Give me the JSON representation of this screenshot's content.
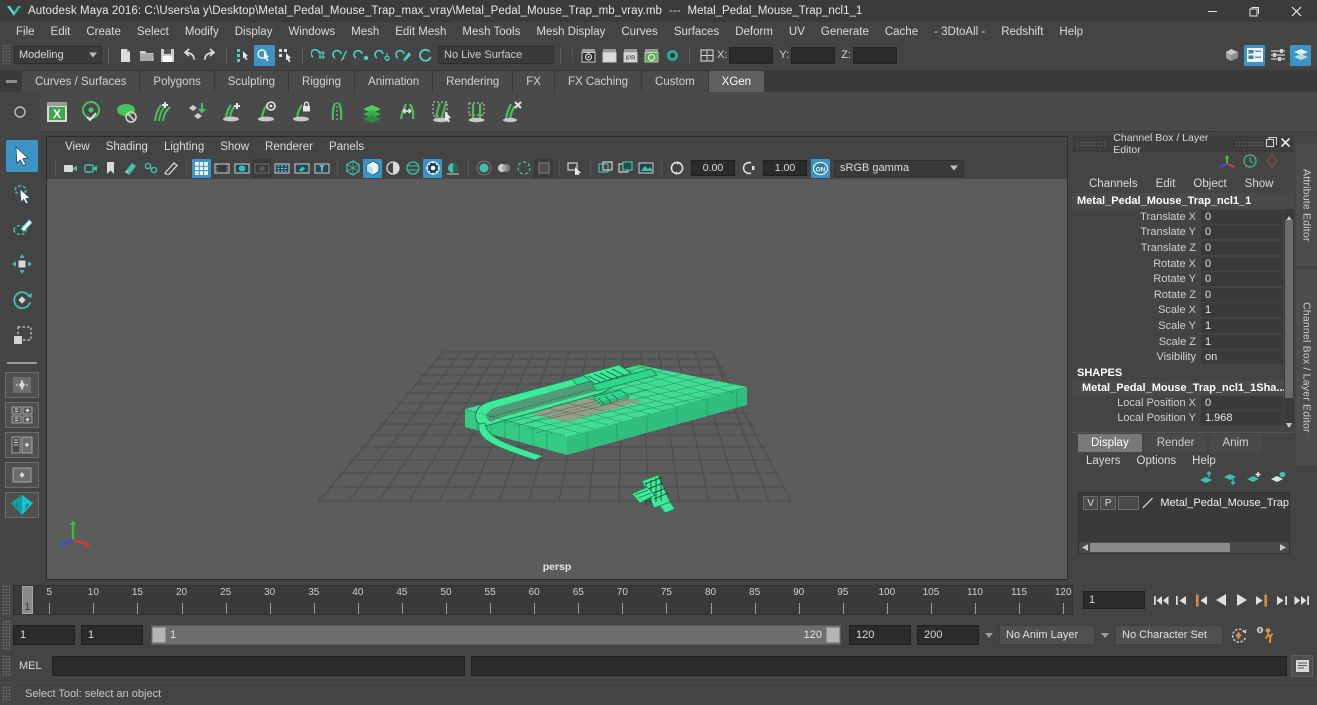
{
  "window": {
    "app_title": "Autodesk Maya 2016: C:\\Users\\a y\\Desktop\\Metal_Pedal_Mouse_Trap_max_vray\\Metal_Pedal_Mouse_Trap_mb_vray.mb",
    "separator": "---",
    "active_object": "Metal_Pedal_Mouse_Trap_ncl1_1",
    "minimize": "─",
    "maximize": "❐",
    "close": "✕"
  },
  "menubar": {
    "items": [
      "File",
      "Edit",
      "Create",
      "Select",
      "Modify",
      "Display",
      "Windows",
      "Mesh",
      "Edit Mesh",
      "Mesh Tools",
      "Mesh Display",
      "Curves",
      "Surfaces",
      "Deform",
      "UV",
      "Generate",
      "Cache",
      "- 3DtoAll -",
      "Redshift",
      "Help"
    ]
  },
  "statusline": {
    "menu_set": "Modeling",
    "live_surface": "No Live Surface",
    "axis_x_label": "X:",
    "axis_y_label": "Y:",
    "axis_z_label": "Z:",
    "axis_x_value": "",
    "axis_y_value": "",
    "axis_z_value": "",
    "icons": [
      "new-scene-icon",
      "open-scene-icon",
      "save-scene-icon",
      "undo-icon",
      "redo-icon",
      "select-by-hierarchy-icon",
      "select-by-object-icon",
      "select-by-component-icon",
      "snap-to-grid-icon",
      "snap-to-curve-icon",
      "snap-to-point-icon",
      "snap-to-projected-center-icon",
      "snap-to-view-plane-icon",
      "make-live-icon",
      "render-view-icon",
      "render-current-frame-icon",
      "ipr-render-icon",
      "render-settings-icon",
      "hypershade-icon",
      "input-output-connections-icon",
      "show-manipulator-icon",
      "attribute-editor-icon",
      "tool-settings-icon",
      "channel-box-icon"
    ]
  },
  "shelf": {
    "tabs": [
      "Curves / Surfaces",
      "Polygons",
      "Sculpting",
      "Rigging",
      "Animation",
      "Rendering",
      "FX",
      "FX Caching",
      "Custom",
      "XGen"
    ],
    "active_tab": "XGen",
    "icons": [
      "xgen-window-icon",
      "xgen-preview-icon",
      "xgen-disable-preview-icon",
      "xgen-add-guides-icon",
      "xgen-convert-primitives-icon",
      "xgen-add-groomable-splines-icon",
      "xgen-show-guide-icon",
      "xgen-freeze-guide-icon",
      "xgen-mirror-guides-icon",
      "xgen-duplicate-description-icon",
      "xgen-groom-brush-icon",
      "xgen-select-guides-icon",
      "xgen-select-region-icon",
      "xgen-delete-guides-icon"
    ]
  },
  "toolbox": {
    "tools": [
      {
        "name": "select-tool",
        "active": true
      },
      {
        "name": "lasso-select-tool",
        "active": false
      },
      {
        "name": "paint-select-tool",
        "active": false
      },
      {
        "name": "move-tool",
        "active": false
      },
      {
        "name": "rotate-tool",
        "active": false
      },
      {
        "name": "scale-tool",
        "active": false
      }
    ],
    "layouts": [
      "single-perspective-layout",
      "four-view-layout",
      "outliner-persp-layout",
      "persp-graph-layout",
      "hypershade-persp-layout"
    ]
  },
  "viewport": {
    "menus": [
      "View",
      "Shading",
      "Lighting",
      "Show",
      "Renderer",
      "Panels"
    ],
    "camera_label": "persp",
    "exposure_value": "0.00",
    "gamma_value": "1.00",
    "color_management": "sRGB gamma",
    "background_color": "#5c5c5c",
    "selection_color": "#4cf2a1",
    "grid_color": "#4a4a4a",
    "toolbar_icons": [
      "select-camera-icon",
      "camera-attributes-icon",
      "bookmark-icon",
      "image-plane-icon",
      "two-d-pan-zoom-icon",
      "grease-pencil-icon",
      "grid-toggle-icon",
      "film-gate-icon",
      "resolution-gate-icon",
      "gate-mask-icon",
      "xray-joints-icon",
      "xray-icon",
      "texture-border-icon",
      "wireframe-icon",
      "smooth-shade-all-icon",
      "shaded-wireframe-icon",
      "textured-icon",
      "use-all-lights-icon",
      "shadows-icon",
      "ambient-occlusion-icon",
      "motion-blur-icon",
      "multisample-icon",
      "depth-of-field-icon",
      "isolate-select-icon",
      "viewport-snapshot-icon",
      "grab-icon",
      "playblast-icon",
      "exposure-icon",
      "gamma-icon",
      "color-management-toggle-icon"
    ]
  },
  "channelbox": {
    "panel_title": "Channel Box / Layer Editor",
    "float_icon": "undock-icon",
    "close_icon": "close-icon",
    "menus": [
      "Channels",
      "Edit",
      "Object",
      "Show"
    ],
    "object_name": "Metal_Pedal_Mouse_Trap_ncl1_1",
    "channels": [
      {
        "label": "Translate X",
        "value": "0"
      },
      {
        "label": "Translate Y",
        "value": "0"
      },
      {
        "label": "Translate Z",
        "value": "0"
      },
      {
        "label": "Rotate X",
        "value": "0"
      },
      {
        "label": "Rotate Y",
        "value": "0"
      },
      {
        "label": "Rotate Z",
        "value": "0"
      },
      {
        "label": "Scale X",
        "value": "1"
      },
      {
        "label": "Scale Y",
        "value": "1"
      },
      {
        "label": "Scale Z",
        "value": "1"
      },
      {
        "label": "Visibility",
        "value": "on"
      }
    ],
    "shapes_header": "SHAPES",
    "shape_name": "Metal_Pedal_Mouse_Trap_ncl1_1Sha...",
    "shape_channels": [
      {
        "label": "Local Position X",
        "value": "0"
      },
      {
        "label": "Local Position Y",
        "value": "1.968"
      }
    ]
  },
  "layereditor": {
    "tabs": [
      "Display",
      "Render",
      "Anim"
    ],
    "active_tab": "Display",
    "menus": [
      "Layers",
      "Options",
      "Help"
    ],
    "toolbar_icons": [
      "move-layer-up-icon",
      "move-layer-down-icon",
      "create-empty-layer-icon",
      "create-layer-from-selected-icon"
    ],
    "layers": [
      {
        "visibility": "V",
        "playback": "P",
        "shading": "",
        "name": "Metal_Pedal_Mouse_Trap"
      }
    ]
  },
  "docktabs": {
    "items": [
      "Attribute Editor",
      "Channel Box / Layer Editor"
    ]
  },
  "timeline": {
    "ticks": [
      5,
      10,
      15,
      20,
      25,
      30,
      35,
      40,
      45,
      50,
      55,
      60,
      65,
      70,
      75,
      80,
      85,
      90,
      95,
      100,
      105,
      110,
      115,
      120
    ],
    "start": 1,
    "end": 120,
    "current_frame": "1",
    "current_frame_field": "1",
    "playback_buttons": [
      "go-to-start-icon",
      "step-back-frame-icon",
      "step-back-key-icon",
      "play-backwards-icon",
      "play-forwards-icon",
      "step-forward-key-icon",
      "step-forward-frame-icon",
      "go-to-end-icon"
    ]
  },
  "rangeslider": {
    "anim_start": "1",
    "range_start": "1",
    "bar_start_label": "1",
    "bar_end_label": "120",
    "range_end": "120",
    "anim_end": "200",
    "anim_layer": "No Anim Layer",
    "character_set": "No Character Set",
    "auto_key_icon": "auto-keyframe-icon",
    "anim_prefs_icon": "animation-preferences-icon"
  },
  "commandline": {
    "language_label": "MEL",
    "input_value": "",
    "output_value": "",
    "script_editor_icon": "script-editor-icon"
  },
  "helpline": {
    "text": "Select Tool: select an object"
  }
}
